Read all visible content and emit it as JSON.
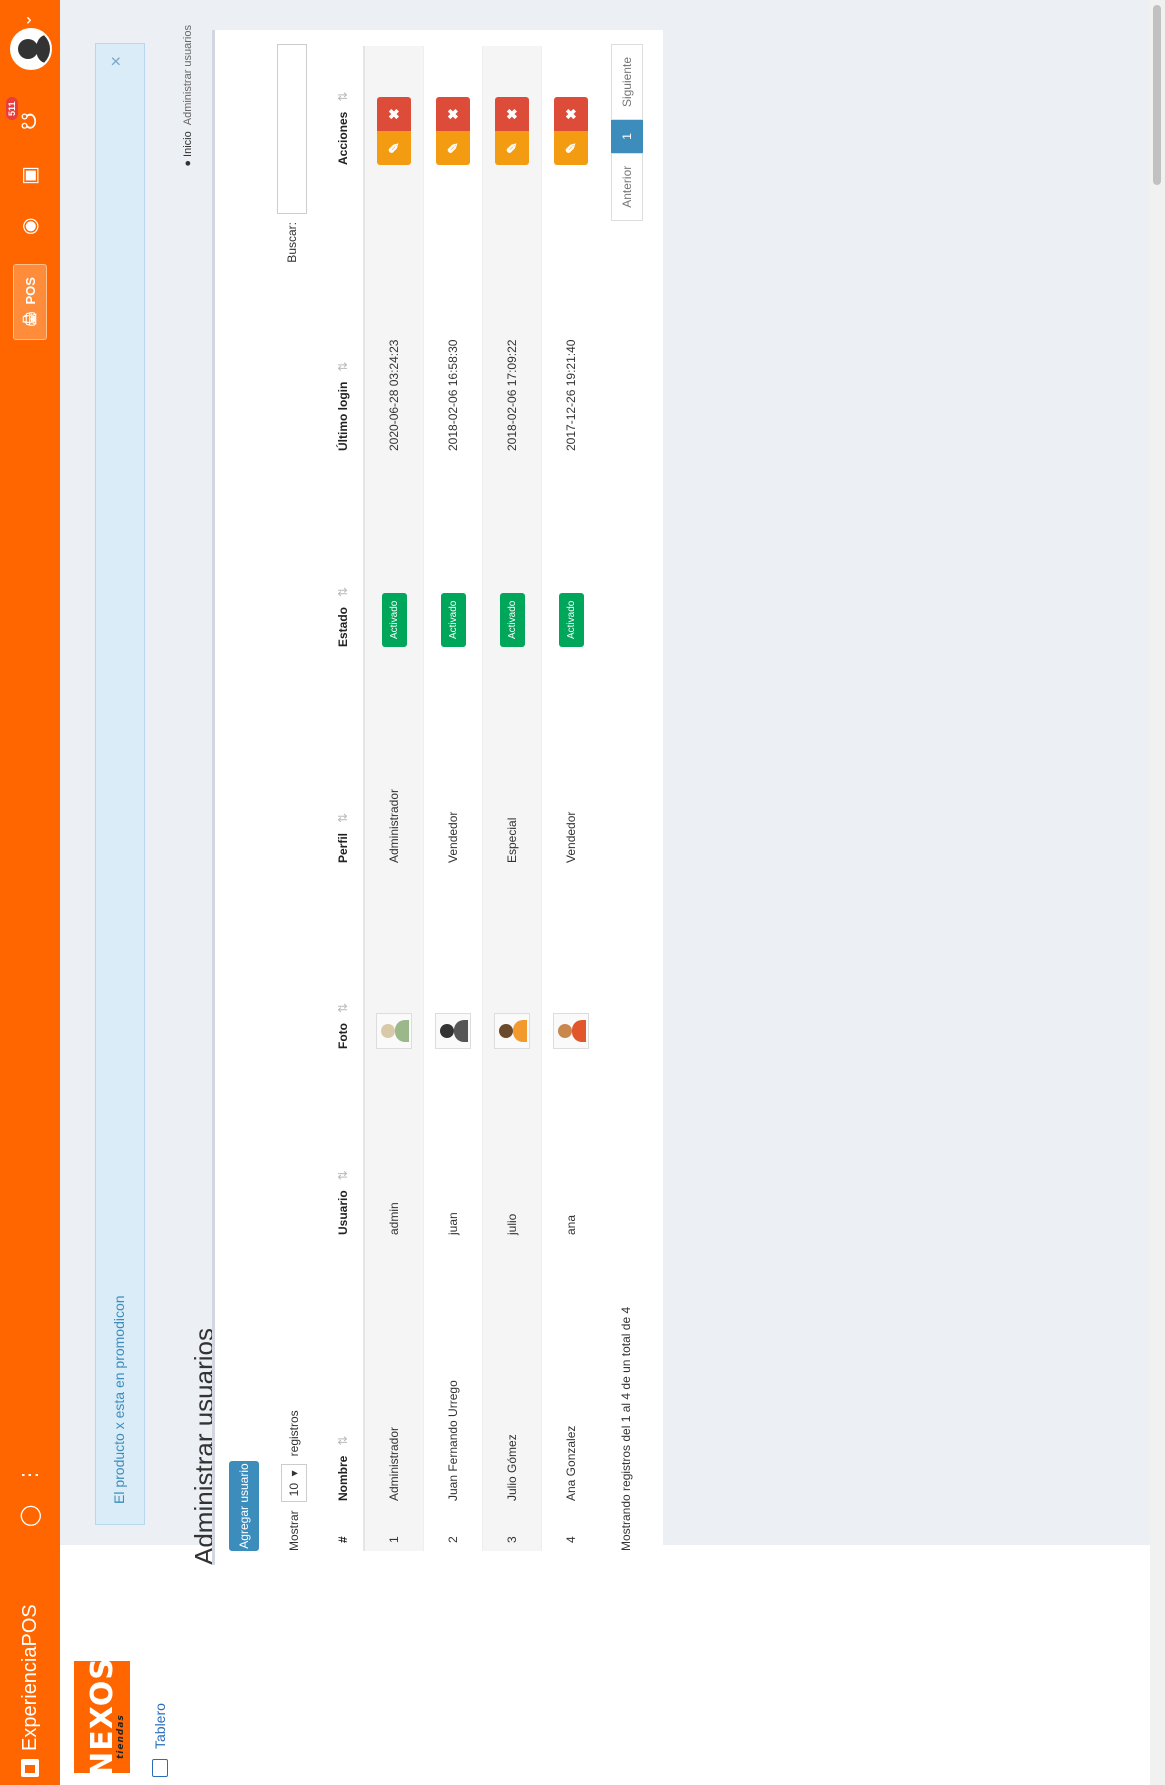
{
  "app": {
    "title": "ExperienciaPOS",
    "pos_label": "POS",
    "notification_count": "511"
  },
  "sidebar": {
    "logo_text": "NEXOS",
    "logo_sub": "tiendas",
    "items": [
      {
        "label": "Tablero",
        "icon": "home-icon"
      }
    ]
  },
  "alert": {
    "text": "El producto x esta en promodicon",
    "close": "×"
  },
  "page": {
    "title": "Administrar usuarios"
  },
  "breadcrumb": {
    "home": "Inicio",
    "current": "Administrar usuarios"
  },
  "toolbar": {
    "add_label": "Agregar usuario"
  },
  "table_controls": {
    "show_label": "Mostrar",
    "page_size": "10",
    "records_label": "registros",
    "search_label": "Buscar:"
  },
  "table": {
    "headers": [
      "#",
      "Nombre",
      "Usuario",
      "Foto",
      "Perfil",
      "Estado",
      "Último login",
      "Acciones"
    ],
    "rows": [
      {
        "num": "1",
        "name": "Administrador",
        "user": "admin",
        "profile": "Administrador",
        "status": "Activado",
        "last_login": "2020-06-28 03:24:23"
      },
      {
        "num": "2",
        "name": "Juan Fernando Urrego",
        "user": "juan",
        "profile": "Vendedor",
        "status": "Activado",
        "last_login": "2018-02-06 16:58:30"
      },
      {
        "num": "3",
        "name": "Julio Gómez",
        "user": "julio",
        "profile": "Especial",
        "status": "Activado",
        "last_login": "2018-02-06 17:09:22"
      },
      {
        "num": "4",
        "name": "Ana Gonzalez",
        "user": "ana",
        "profile": "Vendedor",
        "status": "Activado",
        "last_login": "2017-12-26 19:21:40"
      }
    ]
  },
  "footer": {
    "info": "Mostrando registros del 1 al 4 de un total de 4",
    "prev": "Anterior",
    "page": "1",
    "next": "Siguiente"
  },
  "colors": {
    "topbar": "#ff6600",
    "primary": "#3c8dbc",
    "success": "#00a65a",
    "warning": "#f39c12",
    "danger": "#dd4b39"
  }
}
